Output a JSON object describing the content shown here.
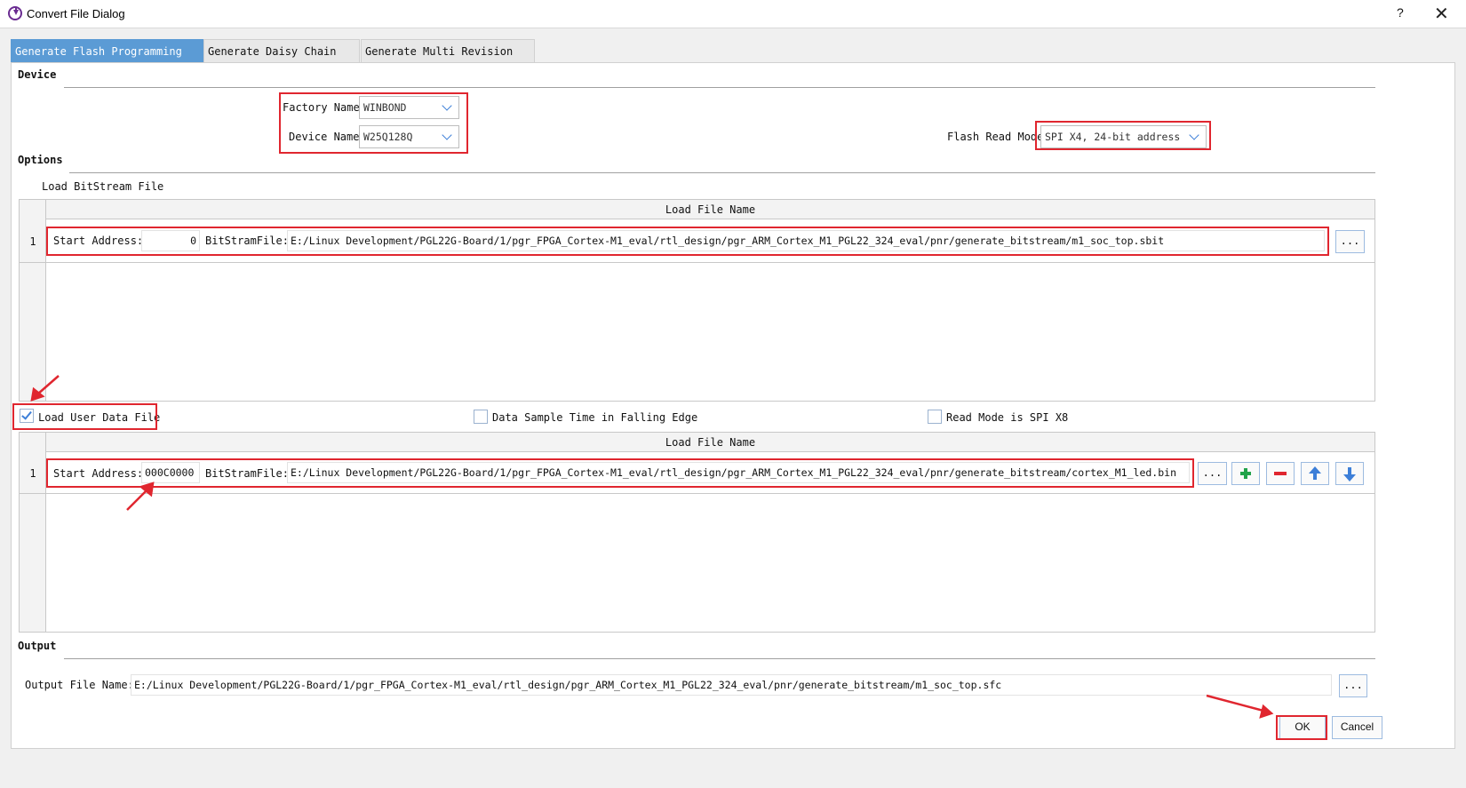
{
  "window": {
    "title": "Convert File Dialog",
    "help": "?",
    "close": "✕"
  },
  "tabs": [
    {
      "label": "Generate Flash Programming File",
      "active": true
    },
    {
      "label": "Generate Daisy Chain File",
      "active": false
    },
    {
      "label": "Generate Multi Revision File",
      "active": false
    }
  ],
  "device": {
    "section": "Device",
    "factory_label": "Factory Name",
    "factory_value": "WINBOND",
    "device_label": "Device Name",
    "device_value": "W25Q128Q",
    "flash_mode_label": "Flash Read Mode",
    "flash_mode_value": "SPI X4, 24-bit address"
  },
  "options": {
    "section": "Options",
    "load_bitstream_label": "Load BitStream File",
    "bitstream_grid": {
      "header": "Load File Name",
      "rows": [
        {
          "index": "1",
          "start_label": "Start Address:",
          "start_value": "0",
          "file_label": "BitStramFile:",
          "file_value": "E:/Linux Development/PGL22G-Board/1/pgr_FPGA_Cortex-M1_eval/rtl_design/pgr_ARM_Cortex_M1_PGL22_324_eval/pnr/generate_bitstream/m1_soc_top.sbit",
          "browse": "..."
        }
      ]
    },
    "load_user_data": {
      "label": "Load User Data File",
      "checked": true
    },
    "falling_edge": {
      "label": "Data Sample Time in Falling Edge",
      "checked": false
    },
    "spi_x8": {
      "label": "Read Mode is SPI X8",
      "checked": false
    },
    "user_grid": {
      "header": "Load File Name",
      "rows": [
        {
          "index": "1",
          "start_label": "Start Address:",
          "start_value": "000C0000",
          "file_label": "BitStramFile:",
          "file_value": "E:/Linux Development/PGL22G-Board/1/pgr_FPGA_Cortex-M1_eval/rtl_design/pgr_ARM_Cortex_M1_PGL22_324_eval/pnr/generate_bitstream/cortex_M1_led.bin",
          "browse": "..."
        }
      ]
    }
  },
  "output": {
    "section": "Output",
    "file_label": "Output File Name:",
    "file_value": "E:/Linux Development/PGL22G-Board/1/pgr_FPGA_Cortex-M1_eval/rtl_design/pgr_ARM_Cortex_M1_PGL22_324_eval/pnr/generate_bitstream/m1_soc_top.sfc",
    "browse": "..."
  },
  "buttons": {
    "ok": "OK",
    "cancel": "Cancel"
  },
  "colors": {
    "accent": "#5b9bd5",
    "annotation": "#e0262f",
    "add": "#22a34a",
    "remove": "#e0262f",
    "move": "#3d7fd8"
  }
}
